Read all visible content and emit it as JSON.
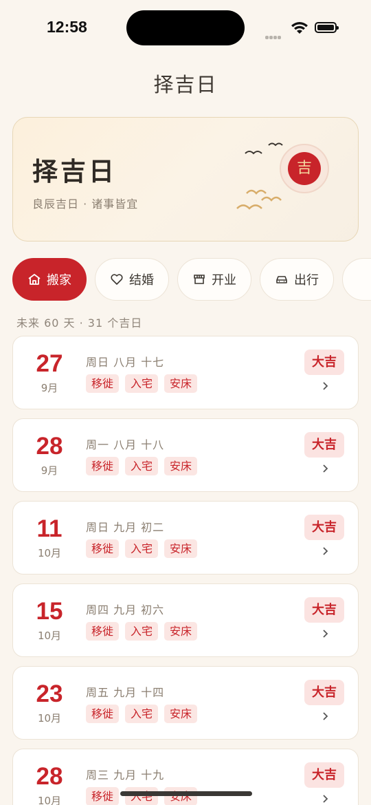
{
  "status": {
    "time": "12:58"
  },
  "nav": {
    "title": "择吉日"
  },
  "hero": {
    "title": "择吉日",
    "subtitle": "良辰吉日 · 诸事皆宜",
    "seal": "吉"
  },
  "categories": [
    {
      "label": "搬家",
      "icon": "house-icon",
      "active": true
    },
    {
      "label": "结婚",
      "icon": "heart-icon",
      "active": false
    },
    {
      "label": "开业",
      "icon": "shop-icon",
      "active": false
    },
    {
      "label": "出行",
      "icon": "car-icon",
      "active": false
    }
  ],
  "summary": "未来 60 天 · 31 个吉日",
  "days": [
    {
      "day": "27",
      "month": "9月",
      "lunar": "周日  八月 十七",
      "tags": [
        "移徙",
        "入宅",
        "安床"
      ],
      "badge": "大吉"
    },
    {
      "day": "28",
      "month": "9月",
      "lunar": "周一  八月 十八",
      "tags": [
        "移徙",
        "入宅",
        "安床"
      ],
      "badge": "大吉"
    },
    {
      "day": "11",
      "month": "10月",
      "lunar": "周日  九月 初二",
      "tags": [
        "移徙",
        "入宅",
        "安床"
      ],
      "badge": "大吉"
    },
    {
      "day": "15",
      "month": "10月",
      "lunar": "周四  九月 初六",
      "tags": [
        "移徙",
        "入宅",
        "安床"
      ],
      "badge": "大吉"
    },
    {
      "day": "23",
      "month": "10月",
      "lunar": "周五  九月 十四",
      "tags": [
        "移徙",
        "入宅",
        "安床"
      ],
      "badge": "大吉"
    },
    {
      "day": "28",
      "month": "10月",
      "lunar": "周三  九月 十九",
      "tags": [
        "移徙",
        "入宅",
        "安床"
      ],
      "badge": "大吉"
    }
  ],
  "colors": {
    "accent": "#c8242a",
    "background": "#faf5ee",
    "tag_bg": "#fbe6e3",
    "gold": "#d8ad6a"
  }
}
